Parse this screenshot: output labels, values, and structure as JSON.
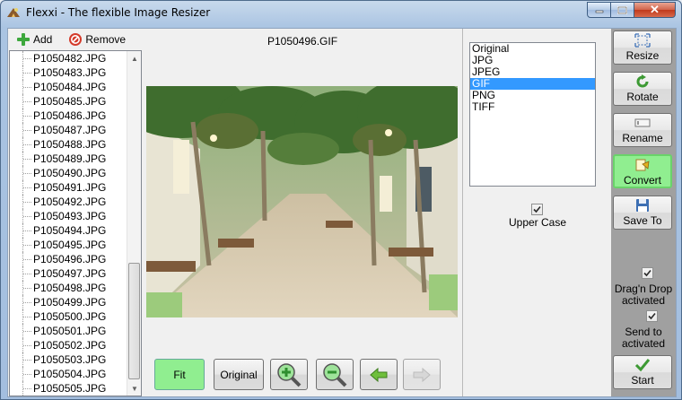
{
  "window": {
    "title": "Flexxi - The flexible Image Resizer",
    "close_glyph": "✕"
  },
  "toolbar": {
    "add_label": "Add",
    "remove_label": "Remove"
  },
  "files": [
    "P1050482.JPG",
    "P1050483.JPG",
    "P1050484.JPG",
    "P1050485.JPG",
    "P1050486.JPG",
    "P1050487.JPG",
    "P1050488.JPG",
    "P1050489.JPG",
    "P1050490.JPG",
    "P1050491.JPG",
    "P1050492.JPG",
    "P1050493.JPG",
    "P1050494.JPG",
    "P1050495.JPG",
    "P1050496.JPG",
    "P1050497.JPG",
    "P1050498.JPG",
    "P1050499.JPG",
    "P1050500.JPG",
    "P1050501.JPG",
    "P1050502.JPG",
    "P1050503.JPG",
    "P1050504.JPG",
    "P1050505.JPG"
  ],
  "preview": {
    "filename": "P1050496.GIF"
  },
  "nav": {
    "fit_label": "Fit",
    "original_label": "Original"
  },
  "formats": {
    "items": [
      "Original",
      "JPG",
      "JPEG",
      "GIF",
      "PNG",
      "TIFF"
    ],
    "selected": "GIF",
    "upper_case_label": "Upper Case",
    "upper_case_checked": true
  },
  "actions": {
    "resize": "Resize",
    "rotate": "Rotate",
    "rename": "Rename",
    "convert": "Convert",
    "save_to": "Save To",
    "drag_drop": "Drag'n Drop activated",
    "send_to": "Send to activated",
    "start": "Start",
    "active": "convert"
  },
  "colors": {
    "active_button": "#90ee90",
    "selection": "#3399ff",
    "action_column": "#a0a0a0"
  }
}
